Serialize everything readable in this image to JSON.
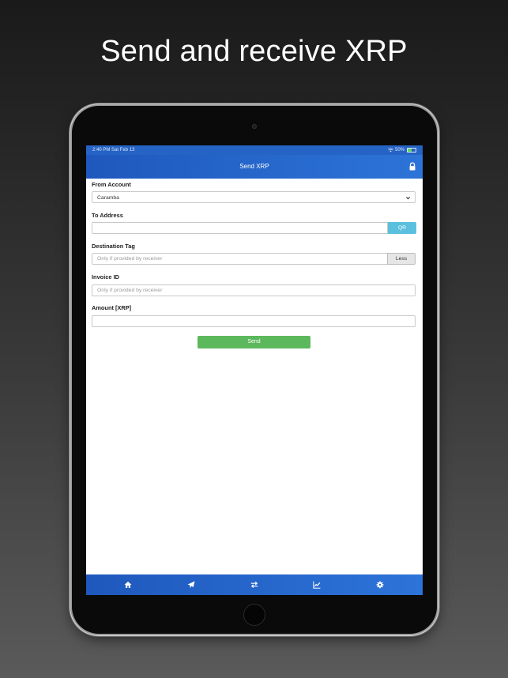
{
  "headline": "Send and receive XRP",
  "statusbar": {
    "time_date": "2:40 PM   Sat Feb 13",
    "battery_percent": "50%"
  },
  "navbar": {
    "title": "Send XRP"
  },
  "form": {
    "from_account": {
      "label": "From Account",
      "selected": "Caramba"
    },
    "to_address": {
      "label": "To Address",
      "value": "",
      "qr_label": "QR"
    },
    "destination_tag": {
      "label": "Destination Tag",
      "placeholder": "Only if provided by receiver",
      "less_label": "Less"
    },
    "invoice_id": {
      "label": "Invoice ID",
      "placeholder": "Only if provided by receiver"
    },
    "amount": {
      "label": "Amount [XRP]",
      "value": ""
    },
    "send_label": "Send"
  },
  "tabbar": {
    "items": [
      {
        "icon": "home-icon"
      },
      {
        "icon": "paper-plane-icon"
      },
      {
        "icon": "exchange-icon"
      },
      {
        "icon": "line-chart-icon"
      },
      {
        "icon": "gear-icon"
      }
    ]
  },
  "colors": {
    "nav_blue": "#2563c4",
    "qr_button": "#5bc0de",
    "send_button": "#5cb85c",
    "less_button": "#e6e6e6"
  }
}
